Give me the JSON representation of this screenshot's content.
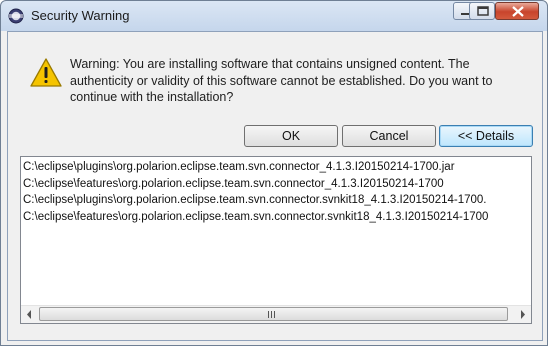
{
  "window": {
    "title": "Security Warning",
    "controls": [
      "minimize-icon",
      "maximize-icon",
      "close-icon"
    ]
  },
  "dialog": {
    "icon": "warning-icon",
    "message": "Warning: You are installing software that contains unsigned content. The authenticity or validity of this software cannot be established. Do you want to continue with the installation?",
    "buttons": {
      "ok": "OK",
      "cancel": "Cancel",
      "details": "<< Details"
    }
  },
  "details_list": {
    "items": [
      "C:\\eclipse\\plugins\\org.polarion.eclipse.team.svn.connector_4.1.3.I20150214-1700.jar",
      "C:\\eclipse\\features\\org.polarion.eclipse.team.svn.connector_4.1.3.I20150214-1700",
      "C:\\eclipse\\plugins\\org.polarion.eclipse.team.svn.connector.svnkit18_4.1.3.I20150214-1700.",
      "C:\\eclipse\\features\\org.polarion.eclipse.team.svn.connector.svnkit18_4.1.3.I20150214-1700"
    ]
  },
  "colors": {
    "default_button_border": "#3c7fb1",
    "close_button": "#c8442c",
    "warning_yellow": "#f5c400"
  }
}
